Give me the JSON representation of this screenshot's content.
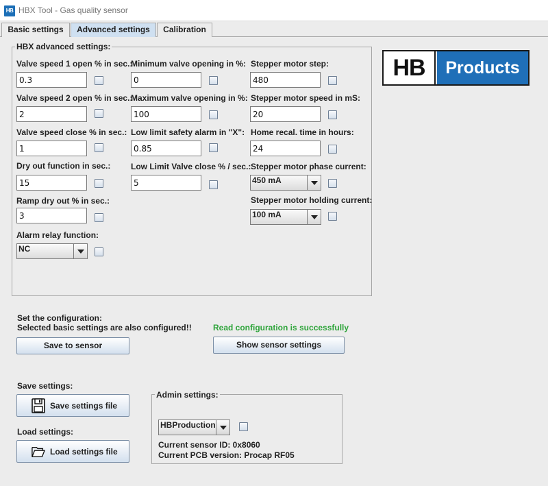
{
  "window": {
    "icon_text": "HB",
    "title": "HBX Tool - Gas quality sensor"
  },
  "tabs": [
    {
      "label": "Basic settings",
      "active": false
    },
    {
      "label": "Advanced settings",
      "active": true
    },
    {
      "label": "Calibration",
      "active": false
    }
  ],
  "advanced": {
    "legend": "HBX advanced settings:",
    "valve_speed_1": {
      "label": "Valve speed 1 open % in sec.:",
      "value": "0.3",
      "checked": false
    },
    "valve_speed_2": {
      "label": "Valve speed 2 open % in sec.:",
      "value": "2",
      "checked": false
    },
    "valve_speed_close": {
      "label": "Valve speed close % in sec.:",
      "value": "1",
      "checked": false
    },
    "dry_out": {
      "label": "Dry out function in sec.:",
      "value": "15",
      "checked": false
    },
    "ramp_dry_out": {
      "label": "Ramp dry out % in sec.:",
      "value": "3",
      "checked": false
    },
    "alarm_relay": {
      "label": "Alarm relay function:",
      "selected": "NC",
      "checked": false
    },
    "min_valve_opening": {
      "label": "Minimum valve opening in %:",
      "value": "0",
      "checked": false
    },
    "max_valve_opening": {
      "label": "Maximum valve opening in %:",
      "value": "100",
      "checked": false
    },
    "low_limit_alarm": {
      "label": "Low limit safety alarm in \"X\":",
      "value": "0.85",
      "checked": false
    },
    "low_limit_valve_close": {
      "label": "Low Limit Valve close % / sec.:",
      "value": "5",
      "checked": false
    },
    "stepper_step": {
      "label": "Stepper motor step:",
      "value": "480",
      "checked": false
    },
    "stepper_speed": {
      "label": "Stepper motor speed in mS:",
      "value": "20",
      "checked": false
    },
    "home_recal": {
      "label": "Home recal. time in hours:",
      "value": "24",
      "checked": false
    },
    "phase_current": {
      "label": "Stepper motor phase current:",
      "selected": "450 mA",
      "checked": false
    },
    "holding_current": {
      "label": "Stepper motor holding current:",
      "selected": "100 mA",
      "checked": false
    }
  },
  "logo": {
    "left_text": "HB",
    "right_text": "Products"
  },
  "config": {
    "line1": "Set the configuration:",
    "line2": "Selected basic settings are also configured!!",
    "save_button": "Save to sensor",
    "status": "Read configuration is successfully",
    "show_button": "Show sensor settings"
  },
  "files": {
    "save_label": "Save settings:",
    "save_button": "Save settings file",
    "load_label": "Load settings:",
    "load_button": "Load settings file"
  },
  "admin": {
    "legend": "Admin settings:",
    "selected": "HBProduction",
    "checked": false,
    "sensor_id": "Current sensor ID: 0x8060",
    "pcb_version": "Current PCB version: Procap RF05"
  },
  "colors": {
    "background": "#ececec",
    "active_tab": "#cfe0f1",
    "success_text": "#2ea43a",
    "logo_blue": "#1f6fb8"
  },
  "icons": {
    "save_button": "floppy-disk-icon",
    "load_button": "folder-open-icon",
    "combo_arrow": "chevron-down-icon"
  }
}
